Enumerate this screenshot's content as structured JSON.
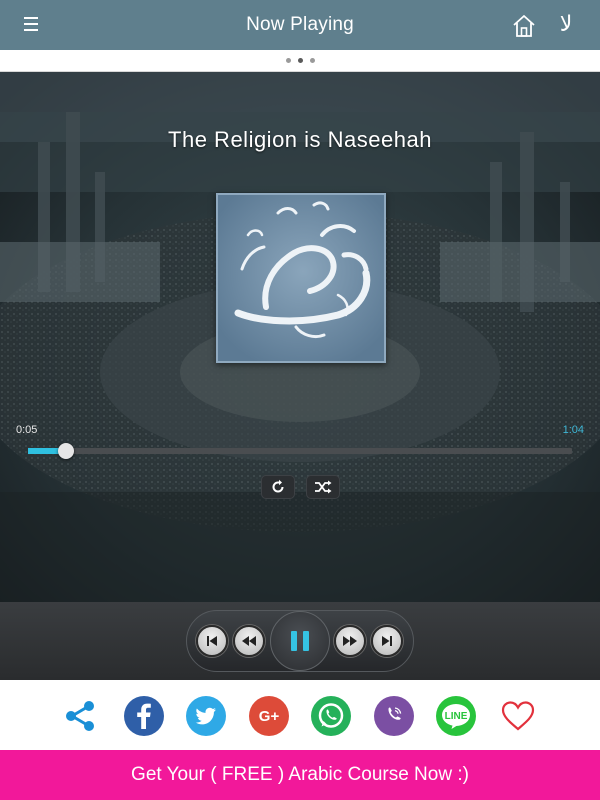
{
  "header": {
    "title": "Now Playing",
    "menu_icon": "hamburger-menu-icon",
    "home_icon": "home-icon",
    "lang_icon": "arabic-language-icon",
    "lang_glyph": "لا"
  },
  "pager": {
    "count": 3,
    "active_index": 1
  },
  "player": {
    "track_title": "The Religion is Naseehah",
    "artwork": "muhammad-calligraphy-artwork",
    "elapsed": "0:05",
    "duration": "1:04",
    "progress_fraction": 0.069,
    "repeat_icon": "repeat-icon",
    "shuffle_icon": "shuffle-icon"
  },
  "controls": {
    "skip_previous_icon": "skip-previous-icon",
    "rewind_icon": "rewind-icon",
    "pause_icon": "pause-icon",
    "fast_forward_icon": "fast-forward-icon",
    "skip_next_icon": "skip-next-icon"
  },
  "share": {
    "items": [
      {
        "name": "share",
        "color": "#1a8fd6"
      },
      {
        "name": "facebook",
        "color": "#2f5fa8"
      },
      {
        "name": "twitter",
        "color": "#2fa9e6"
      },
      {
        "name": "google-plus",
        "color": "#dd4b39"
      },
      {
        "name": "whatsapp",
        "color": "#25b15a"
      },
      {
        "name": "viber",
        "color": "#7b4fa3"
      },
      {
        "name": "line",
        "color": "#28c43c"
      },
      {
        "name": "favorite",
        "color": "#e2313c"
      }
    ],
    "google_plus_label": "G+",
    "line_label": "LINE"
  },
  "banner": {
    "text": "Get Your ( FREE ) Arabic Course Now :)",
    "color": "#f2189a"
  }
}
